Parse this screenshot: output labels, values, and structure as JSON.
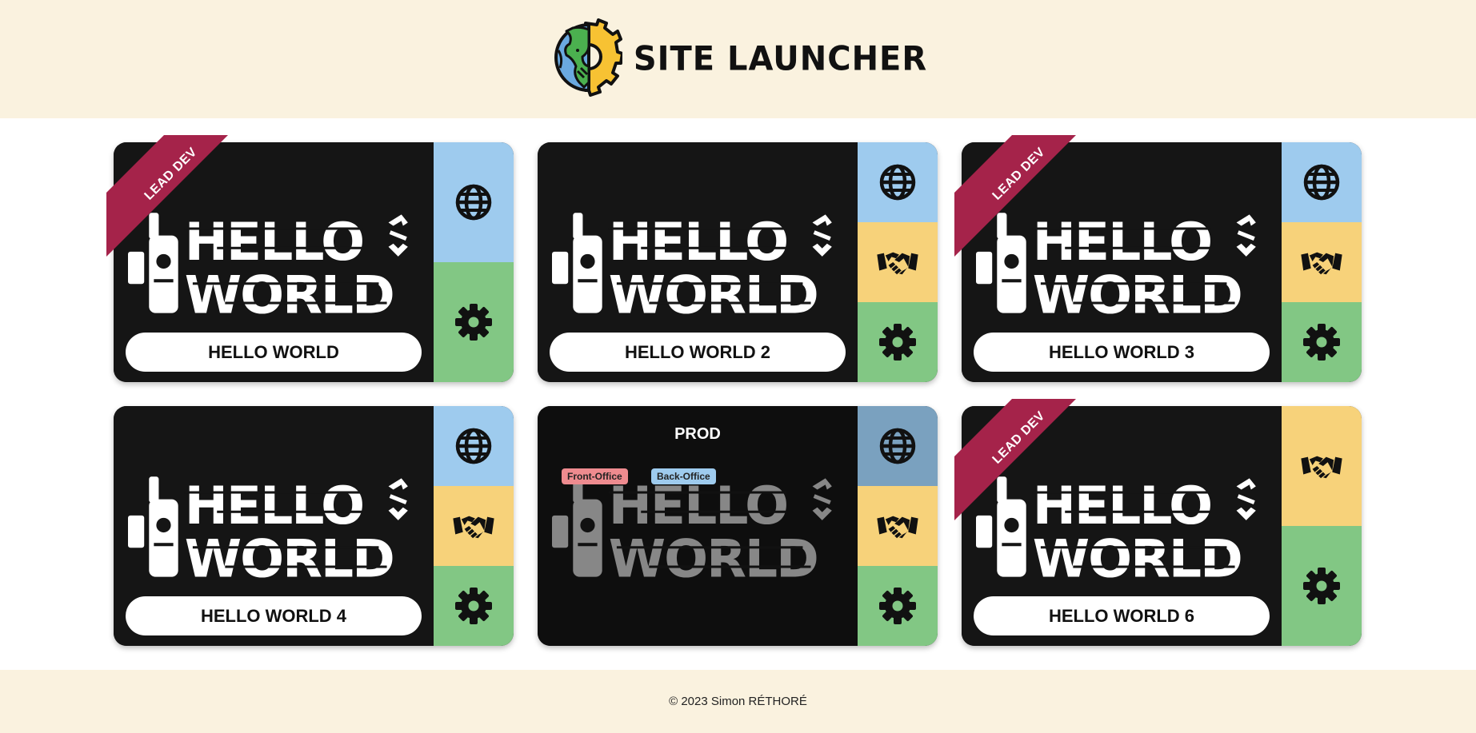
{
  "header": {
    "title": "SITE LAUNCHER",
    "logo_icon": "globe-gear-icon"
  },
  "cards": [
    {
      "name": "HELLO WORLD",
      "ribbon": "LEAD DEV",
      "actions": [
        {
          "icon": "globe-icon",
          "color": "#9ecbee"
        },
        {
          "icon": "gear-icon",
          "color": "#82c784"
        }
      ]
    },
    {
      "name": "HELLO WORLD 2",
      "actions": [
        {
          "icon": "globe-icon",
          "color": "#9ecbee"
        },
        {
          "icon": "handshake-icon",
          "color": "#f7d27a"
        },
        {
          "icon": "gear-icon",
          "color": "#82c784"
        }
      ]
    },
    {
      "name": "HELLO WORLD 3",
      "ribbon": "LEAD DEV",
      "actions": [
        {
          "icon": "globe-icon",
          "color": "#9ecbee"
        },
        {
          "icon": "handshake-icon",
          "color": "#f7d27a"
        },
        {
          "icon": "gear-icon",
          "color": "#82c784"
        }
      ]
    },
    {
      "name": "HELLO WORLD 4",
      "actions": [
        {
          "icon": "globe-icon",
          "color": "#9ecbee"
        },
        {
          "icon": "handshake-icon",
          "color": "#f7d27a"
        },
        {
          "icon": "gear-icon",
          "color": "#82c784"
        }
      ]
    },
    {
      "environment": "PROD",
      "tags": [
        "Front-Office",
        "Back-Office"
      ],
      "actions": [
        {
          "icon": "globe-icon",
          "color": "#7aa1bf"
        },
        {
          "icon": "handshake-icon",
          "color": "#f7d27a"
        },
        {
          "icon": "gear-icon",
          "color": "#82c784"
        }
      ]
    },
    {
      "name": "HELLO WORLD 6",
      "ribbon": "LEAD DEV",
      "actions": [
        {
          "icon": "handshake-icon",
          "color": "#f7d27a"
        },
        {
          "icon": "gear-icon",
          "color": "#82c784"
        }
      ]
    }
  ],
  "logo_text": [
    "HELLO",
    "WORLD"
  ],
  "footer": {
    "text": "© 2023 Simon RÉTHORÉ"
  },
  "colors": {
    "cream": "#faf2df",
    "card_dark": "#151515",
    "ribbon": "#a5234a",
    "tag_front": "#ee8b8f",
    "tag_back": "#9ecbee"
  }
}
